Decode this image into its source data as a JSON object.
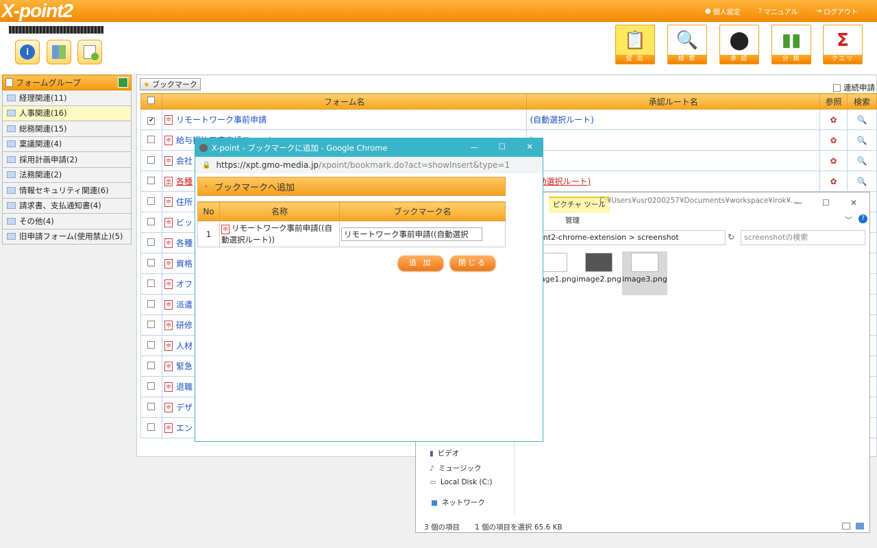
{
  "header": {
    "logo": "X-point2",
    "links": [
      "個人設定",
      "マニュアル",
      "ログアウト"
    ]
  },
  "toolbar": {
    "big_buttons": [
      "提 出",
      "検 索",
      "承 認",
      "分 類",
      "クエリ"
    ]
  },
  "sidebar": {
    "title": "フォームグループ",
    "items": [
      {
        "label": "経理関連(11)"
      },
      {
        "label": "人事関連(16)"
      },
      {
        "label": "総務関連(15)"
      },
      {
        "label": "稟議関連(4)"
      },
      {
        "label": "採用計画申請(2)"
      },
      {
        "label": "法務関連(2)"
      },
      {
        "label": "情報セキュリティ関連(6)"
      },
      {
        "label": "請求書、支払通知書(4)"
      },
      {
        "label": "その他(4)"
      },
      {
        "label": "旧申請フォーム(使用禁止)(5)"
      }
    ]
  },
  "main": {
    "bookmark_label": "ブックマーク",
    "renzoku": "連続申請",
    "columns": [
      "フォーム名",
      "承認ルート名",
      "参照",
      "検索"
    ],
    "rows": [
      {
        "name": "リモートワーク事前申請",
        "route": "(自動選択ルート)"
      },
      {
        "name": "給与振込口座申請フォーム",
        "route": ")"
      },
      {
        "name": "会社",
        "route": ")"
      },
      {
        "name": "各種",
        "route": "自動選択ルート)"
      },
      {
        "name": "住所",
        "route": ""
      },
      {
        "name": "ビッ",
        "route": ""
      },
      {
        "name": "各種",
        "route": ""
      },
      {
        "name": "資格",
        "route": ""
      },
      {
        "name": "オフ",
        "route": ""
      },
      {
        "name": "派遣",
        "route": ""
      },
      {
        "name": "研修",
        "route": ""
      },
      {
        "name": "人材",
        "route": ""
      },
      {
        "name": "緊急",
        "route": ""
      },
      {
        "name": "退職",
        "route": ""
      },
      {
        "name": "デザ",
        "route": ""
      },
      {
        "name": "エン",
        "route": ""
      }
    ]
  },
  "popup": {
    "window_title": "X-point - ブックマークに追加 - Google Chrome",
    "url_host": "https://xpt.gmo-media.jp",
    "url_path": "/xpoint/bookmark.do?act=showInsert&type=1",
    "heading": "ブックマークへ追加",
    "col_no": "No",
    "col_name": "名称",
    "col_bm": "ブックマーク名",
    "row_no": "1",
    "row_name": "リモートワーク事前申請((自動選択ルート))",
    "row_input": "リモートワーク事前申請((自動選択",
    "add_label": "追 加",
    "close_label": "閉じる"
  },
  "explorer": {
    "picture_tools": "ピクチャ ツール",
    "path": "C:¥Users¥usr0200257¥Documents¥workspace¥irok¥...",
    "manage": "管理",
    "address": "oint2-chrome-extension  >  screenshot",
    "search_placeholder": "screenshotの検索",
    "files": [
      "image1.png",
      "image2.png",
      "image3.png"
    ],
    "nav": [
      "ビデオ",
      "ミュージック",
      "Local Disk (C:)",
      "ネットワーク"
    ],
    "status_count": "3 個の項目",
    "status_sel": "1 個の項目を選択  65.6 KB"
  }
}
